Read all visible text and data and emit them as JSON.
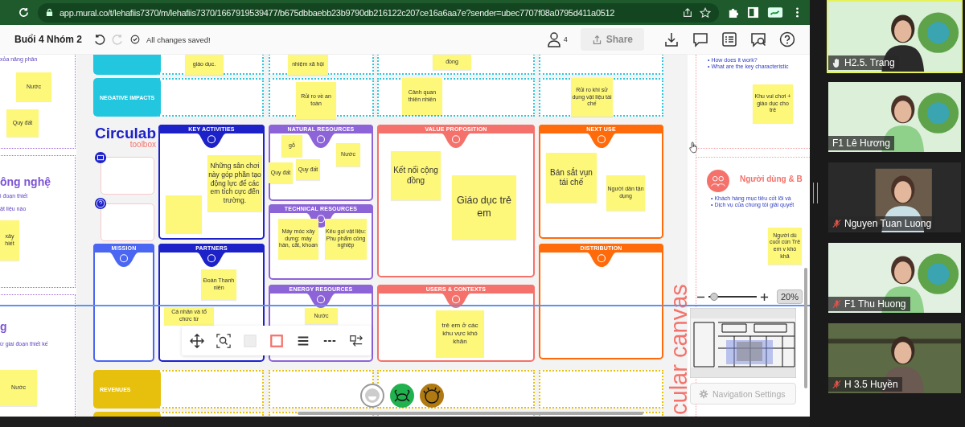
{
  "browser": {
    "url": "app.mural.co/t/lehafiis7370/m/lehafiis7370/1667919539477/b675dbbaebb23b9790db216122c207ce16a6aa7e?sender=ubec7707f08a0795d411a0512"
  },
  "toolbar": {
    "title": "Buổi 4 Nhóm 2",
    "save_status": "All changes saved!",
    "user_count": "4",
    "share": {
      "label": "Share",
      "disabled": true
    }
  },
  "canvas": {
    "side_texts": [
      {
        "text": "xỏa năng phân",
        "kind": "note"
      },
      {
        "text": "ông nghệ",
        "kind": "heading"
      },
      {
        "text": "i đoạn thiết",
        "kind": "note"
      },
      {
        "text": "ật liệu nào",
        "kind": "note"
      },
      {
        "text": "g",
        "kind": "heading"
      },
      {
        "text": "ừ giai đoạn thiết kế",
        "kind": "note"
      }
    ],
    "logo": {
      "name": "Circulab",
      "sub": "toolbox"
    },
    "tabs": [
      {
        "label": "NEGATIVE IMPACTS",
        "color": "#22c6de"
      },
      {
        "label": "REVENUES",
        "color": "#e6c00c"
      }
    ],
    "cards": [
      {
        "title": "KEY ACTIVITIES",
        "color": "#1c21c8"
      },
      {
        "title": "NATURAL RESOURCES",
        "color": "#8d63d8"
      },
      {
        "title": "VALUE PROPOSITION",
        "color": "#f4726b"
      },
      {
        "title": "NEXT USE",
        "color": "#ff6b0a"
      },
      {
        "title": "TECHNICAL RESOURCES",
        "color": "#8d63d8"
      },
      {
        "title": "MISSION",
        "color": "#4a66f2"
      },
      {
        "title": "PARTNERS",
        "color": "#1c21c8"
      },
      {
        "title": "DISTRIBUTION",
        "color": "#ff6b0a"
      },
      {
        "title": "ENERGY RESOURCES",
        "color": "#8d63d8"
      },
      {
        "title": "USERS & CONTEXTS",
        "color": "#f4726b"
      }
    ],
    "stickies": [
      {
        "text": "giáo dục."
      },
      {
        "text": "nhiệm xã hội"
      },
      {
        "text": "đồng"
      },
      {
        "text": "Rủi ro về an toàn"
      },
      {
        "text": "Cảnh quan thiên nhiên"
      },
      {
        "text": "Rủi ro khi sử dụng vật liệu tái chế"
      },
      {
        "text": "Những sân chơi này góp phần tạo động lực để các em tích cực đến trường."
      },
      {
        "text": "gỗ"
      },
      {
        "text": "Nước"
      },
      {
        "text": "Quy đất"
      },
      {
        "text": "Quy đất"
      },
      {
        "text": "Máy móc xây dựng: máy hàn, cắt, khoan"
      },
      {
        "text": "Kêu gọi vật liệu: Phụ phẩm công nghiệp"
      },
      {
        "text": "Đoàn Thanh niên"
      },
      {
        "text": "Cá nhân và tổ chức từ"
      },
      {
        "text": "Nước"
      },
      {
        "text": "Kết nối cộng đồng"
      },
      {
        "text": "Giáo dục trẻ em"
      },
      {
        "text": "trẻ em ở các khu vực khó khăn"
      },
      {
        "text": "Bán sắt vụn tái chế"
      },
      {
        "text": "Người dân tận dụng"
      },
      {
        "text": "Khu vui chơi + giáo dục cho trẻ"
      },
      {
        "text": "Người dù cuối cùn Trẻ em v khó khă"
      },
      {
        "text": "Nước"
      },
      {
        "text": "Quy đất"
      },
      {
        "text": "xây hiết"
      },
      {
        "text": "Nước"
      }
    ],
    "panel": {
      "questions": [
        "• How does it work?",
        "• What are the key characteristic"
      ],
      "heading": "Người dùng & B",
      "bullets": [
        "• Khách hàng mục tiêu cốt lõi và",
        "• Dịch vụ của chúng tôi giải quyết"
      ]
    },
    "vertical_title": "cular canvas",
    "zoom": {
      "level": 0.12,
      "reading": "20%"
    },
    "navigation_settings": "Navigation Settings"
  },
  "participants": [
    {
      "name": "H2.5. Trang",
      "speaking": true,
      "hand_raised": true,
      "muted": false
    },
    {
      "name": "F1 Lê Hương",
      "speaking": false,
      "hand_raised": false,
      "muted": false
    },
    {
      "name": "Nguyen Tuan Luong",
      "speaking": false,
      "hand_raised": false,
      "muted": true
    },
    {
      "name": "F1 Thu Huong",
      "speaking": false,
      "hand_raised": false,
      "muted": true
    },
    {
      "name": "H 3.5 Huyền",
      "speaking": false,
      "hand_raised": false,
      "muted": true
    }
  ]
}
